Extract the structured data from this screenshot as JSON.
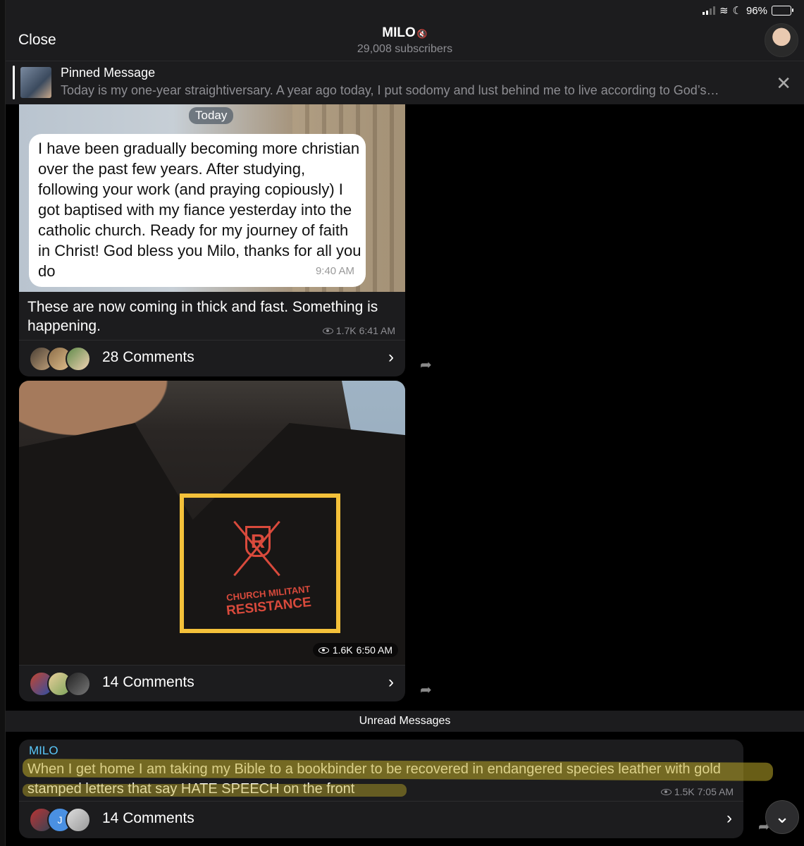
{
  "status_bar": {
    "battery_percent": "96%",
    "battery_level": 0.96
  },
  "header": {
    "close_label": "Close",
    "title": "MILO",
    "subtitle": "29,008 subscribers"
  },
  "pinned": {
    "label": "Pinned Message",
    "text": "Today is my one-year straightiversary. A year ago today, I put sodomy and lust behind me to live according to God’s…"
  },
  "messages": [
    {
      "date_badge": "Today",
      "quoted_text": "I have been gradually becoming more christian over the past few years. After studying, following your work (and praying copiously) I got baptised with my fiance yesterday into the catholic church. Ready for my journey of faith in Christ! God bless you Milo, thanks for all you do",
      "quoted_time": "9:40 AM",
      "caption": "These are now coming in thick and fast. Something is happening.",
      "views": "1.7K",
      "time": "6:41 AM",
      "comments_label": "28 Comments"
    },
    {
      "logo_line1": "CHURCH MILITANT",
      "logo_line2": "RESISTANCE",
      "logo_letter": "R",
      "views": "1.6K",
      "time": "6:50 AM",
      "comments_label": "14 Comments"
    },
    {
      "sender": "MILO",
      "text": "When I get home I am taking my Bible to a bookbinder to be recovered in endangered species leather with gold stamped letters that say HATE SPEECH on the front",
      "views": "1.5K",
      "time": "7:05 AM",
      "comments_label": "14 Comments",
      "comment_avatar_initial": "J"
    }
  ],
  "unread_label": "Unread Messages",
  "icons": {
    "forward": "share-arrow-icon",
    "chevron": "chevron-right-icon",
    "views": "eye-icon",
    "scroll": "chevron-down-icon"
  },
  "colors": {
    "sender_name": "#5ac8fa",
    "highlight_box": "#f4c13a",
    "logo": "#d94a3c"
  }
}
